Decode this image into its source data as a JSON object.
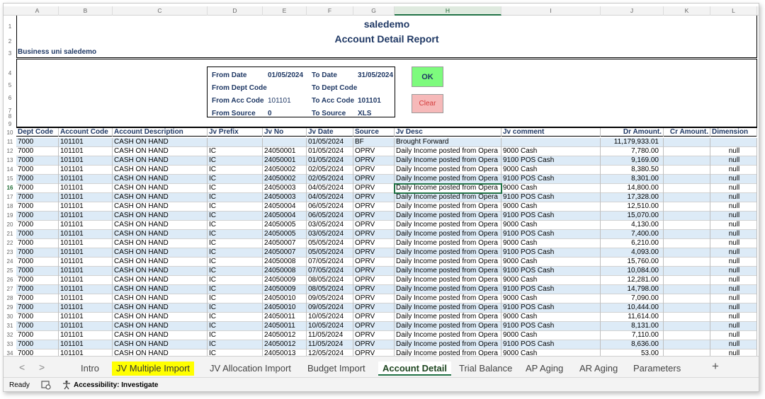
{
  "columns": [
    "A",
    "B",
    "C",
    "D",
    "E",
    "F",
    "G",
    "H",
    "I",
    "J",
    "K",
    "L"
  ],
  "report": {
    "company": "saledemo",
    "title": "Account Detail Report",
    "business_unit": "Business uni saledemo"
  },
  "filters": {
    "from_date_label": "From Date",
    "from_date": "01/05/2024",
    "to_date_label": "To Date",
    "to_date": "31/05/2024",
    "from_dept_label": "From Dept Code",
    "to_dept_label": "To Dept Code",
    "from_acc_label": "From Acc Code",
    "from_acc": "101101",
    "to_acc_label": "To Acc Code",
    "to_acc": "101101",
    "from_source_label": "From Source",
    "from_source": "0",
    "to_source_label": "To Source",
    "to_source": "XLS"
  },
  "buttons": {
    "ok": "OK",
    "clear": "Clear"
  },
  "table": {
    "headers": [
      "Dept Code",
      "Account Code",
      "Account Description",
      "Jv Prefix",
      "Jv No",
      "Jv Date",
      "Source",
      "Jv Desc",
      "Jv comment",
      "Dr Amount.",
      "Cr Amount.",
      "Dimension"
    ],
    "rows": [
      [
        "7000",
        "101101",
        "CASH ON HAND",
        "",
        "",
        "01/05/2024",
        "BF",
        "Brought Forward",
        "",
        "11,179,933.01",
        "",
        ""
      ],
      [
        "7000",
        "101101",
        "CASH ON HAND",
        "IC",
        "24050001",
        "01/05/2024",
        "OPRV",
        "Daily Income posted from Opera",
        "9000 Cash",
        "7,780.00",
        "",
        "null"
      ],
      [
        "7000",
        "101101",
        "CASH ON HAND",
        "IC",
        "24050001",
        "01/05/2024",
        "OPRV",
        "Daily Income posted from Opera",
        "9100 POS Cash",
        "9,169.00",
        "",
        "null"
      ],
      [
        "7000",
        "101101",
        "CASH ON HAND",
        "IC",
        "24050002",
        "02/05/2024",
        "OPRV",
        "Daily Income posted from Opera",
        "9000 Cash",
        "8,380.50",
        "",
        "null"
      ],
      [
        "7000",
        "101101",
        "CASH ON HAND",
        "IC",
        "24050002",
        "02/05/2024",
        "OPRV",
        "Daily Income posted from Opera",
        "9100 POS Cash",
        "8,301.00",
        "",
        "null"
      ],
      [
        "7000",
        "101101",
        "CASH ON HAND",
        "IC",
        "24050003",
        "04/05/2024",
        "OPRV",
        "Daily Income posted from Opera",
        "9000 Cash",
        "14,800.00",
        "",
        "null"
      ],
      [
        "7000",
        "101101",
        "CASH ON HAND",
        "IC",
        "24050003",
        "04/05/2024",
        "OPRV",
        "Daily Income posted from Opera",
        "9100 POS Cash",
        "17,328.00",
        "",
        "null"
      ],
      [
        "7000",
        "101101",
        "CASH ON HAND",
        "IC",
        "24050004",
        "06/05/2024",
        "OPRV",
        "Daily Income posted from Opera",
        "9000 Cash",
        "12,510.00",
        "",
        "null"
      ],
      [
        "7000",
        "101101",
        "CASH ON HAND",
        "IC",
        "24050004",
        "06/05/2024",
        "OPRV",
        "Daily Income posted from Opera",
        "9100 POS Cash",
        "15,070.00",
        "",
        "null"
      ],
      [
        "7000",
        "101101",
        "CASH ON HAND",
        "IC",
        "24050005",
        "03/05/2024",
        "OPRV",
        "Daily Income posted from Opera",
        "9000 Cash",
        "4,130.00",
        "",
        "null"
      ],
      [
        "7000",
        "101101",
        "CASH ON HAND",
        "IC",
        "24050005",
        "03/05/2024",
        "OPRV",
        "Daily Income posted from Opera",
        "9100 POS Cash",
        "7,400.00",
        "",
        "null"
      ],
      [
        "7000",
        "101101",
        "CASH ON HAND",
        "IC",
        "24050007",
        "05/05/2024",
        "OPRV",
        "Daily Income posted from Opera",
        "9000 Cash",
        "6,210.00",
        "",
        "null"
      ],
      [
        "7000",
        "101101",
        "CASH ON HAND",
        "IC",
        "24050007",
        "05/05/2024",
        "OPRV",
        "Daily Income posted from Opera",
        "9100 POS Cash",
        "4,093.00",
        "",
        "null"
      ],
      [
        "7000",
        "101101",
        "CASH ON HAND",
        "IC",
        "24050008",
        "07/05/2024",
        "OPRV",
        "Daily Income posted from Opera",
        "9000 Cash",
        "15,760.00",
        "",
        "null"
      ],
      [
        "7000",
        "101101",
        "CASH ON HAND",
        "IC",
        "24050008",
        "07/05/2024",
        "OPRV",
        "Daily Income posted from Opera",
        "9100 POS Cash",
        "10,084.00",
        "",
        "null"
      ],
      [
        "7000",
        "101101",
        "CASH ON HAND",
        "IC",
        "24050009",
        "08/05/2024",
        "OPRV",
        "Daily Income posted from Opera",
        "9000 Cash",
        "12,281.00",
        "",
        "null"
      ],
      [
        "7000",
        "101101",
        "CASH ON HAND",
        "IC",
        "24050009",
        "08/05/2024",
        "OPRV",
        "Daily Income posted from Opera",
        "9100 POS Cash",
        "14,798.00",
        "",
        "null"
      ],
      [
        "7000",
        "101101",
        "CASH ON HAND",
        "IC",
        "24050010",
        "09/05/2024",
        "OPRV",
        "Daily Income posted from Opera",
        "9000 Cash",
        "7,090.00",
        "",
        "null"
      ],
      [
        "7000",
        "101101",
        "CASH ON HAND",
        "IC",
        "24050010",
        "09/05/2024",
        "OPRV",
        "Daily Income posted from Opera",
        "9100 POS Cash",
        "10,444.00",
        "",
        "null"
      ],
      [
        "7000",
        "101101",
        "CASH ON HAND",
        "IC",
        "24050011",
        "10/05/2024",
        "OPRV",
        "Daily Income posted from Opera",
        "9000 Cash",
        "11,614.00",
        "",
        "null"
      ],
      [
        "7000",
        "101101",
        "CASH ON HAND",
        "IC",
        "24050011",
        "10/05/2024",
        "OPRV",
        "Daily Income posted from Opera",
        "9100 POS Cash",
        "8,131.00",
        "",
        "null"
      ],
      [
        "7000",
        "101101",
        "CASH ON HAND",
        "IC",
        "24050012",
        "11/05/2024",
        "OPRV",
        "Daily Income posted from Opera",
        "9000 Cash",
        "7,110.00",
        "",
        "null"
      ],
      [
        "7000",
        "101101",
        "CASH ON HAND",
        "IC",
        "24050012",
        "11/05/2024",
        "OPRV",
        "Daily Income posted from Opera",
        "9100 POS Cash",
        "8,636.00",
        "",
        "null"
      ],
      [
        "7000",
        "101101",
        "CASH ON HAND",
        "IC",
        "24050013",
        "12/05/2024",
        "OPRV",
        "Daily Income posted from Opera",
        "9000 Cash",
        "53.00",
        "",
        "null"
      ]
    ]
  },
  "row_numbers": [
    "1",
    "2",
    "3",
    "4",
    "5",
    "6",
    "7",
    "8",
    "9",
    "10",
    "11",
    "12",
    "13",
    "14",
    "15",
    "16",
    "17",
    "18",
    "19",
    "20",
    "21",
    "22",
    "23",
    "24",
    "25",
    "26",
    "27",
    "28",
    "29",
    "30",
    "31",
    "32",
    "33",
    "34"
  ],
  "tabs": [
    "Intro",
    "JV Multiple Import",
    "JV Allocation Import",
    "Budget Import",
    "Account Detail",
    "Trial Balance",
    "AP Aging",
    "AR Aging",
    "Parameters"
  ],
  "tab_nav": {
    "prev": "<",
    "next": ">",
    "add": "+"
  },
  "status": {
    "ready": "Ready",
    "accessibility": "Accessibility: Investigate"
  },
  "colors": {
    "accent": "#217346",
    "title": "#1f3864",
    "band": "#ddebf7",
    "ok": "#7dfb7d",
    "clear": "#f6b9b9",
    "highlight_tab": "#ffff00"
  }
}
